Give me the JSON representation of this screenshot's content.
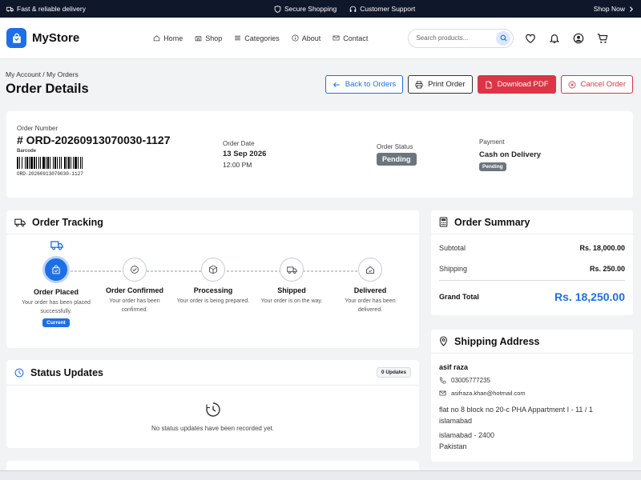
{
  "topbar": {
    "left_text": "Fast & reliable delivery",
    "secure": "Secure Shopping",
    "support": "Customer Support",
    "shop_now": "Shop Now"
  },
  "brand": {
    "name": "MyStore",
    "color": "#1d6fe6"
  },
  "nav": {
    "links": [
      "Home",
      "Shop",
      "Categories",
      "About",
      "Contact"
    ],
    "search_placeholder": "Search products..."
  },
  "breadcrumb": "My Account / My Orders",
  "page_title": "Order Details",
  "actions": {
    "back": "Back to Orders",
    "print": "Print Order",
    "pdf": "Download PDF",
    "cancel": "Cancel Order"
  },
  "order": {
    "number_label": "Order Number",
    "number": "# ORD-20260913070030-1127",
    "barcode_label": "Barcode",
    "barcode_text": "ORD-20260913070030-1127",
    "date_label": "Order Date",
    "date": "13 Sep 2026",
    "time": "12:00 PM",
    "status_label": "Order Status",
    "status": "Pending",
    "payment_label": "Payment",
    "payment_method": "Cash on Delivery",
    "payment_status": "Pending"
  },
  "tracking": {
    "title": "Order Tracking",
    "steps": [
      {
        "title": "Order Placed",
        "desc": "Your order has been placed successfully.",
        "badge": "Current"
      },
      {
        "title": "Order Confirmed",
        "desc": "Your order has been confirmed."
      },
      {
        "title": "Processing",
        "desc": "Your order is being prepared."
      },
      {
        "title": "Shipped",
        "desc": "Your order is on the way."
      },
      {
        "title": "Delivered",
        "desc": "Your order has been delivered."
      }
    ]
  },
  "status_updates": {
    "title": "Status Updates",
    "count": "0 Updates",
    "empty": "No status updates have been recorded yet."
  },
  "summary": {
    "title": "Order Summary",
    "subtotal_label": "Subtotal",
    "subtotal": "Rs. 18,000.00",
    "shipping_label": "Shipping",
    "shipping": "Rs. 250.00",
    "grand_label": "Grand Total",
    "grand": "Rs. 18,250.00"
  },
  "address": {
    "title": "Shipping Address",
    "name": "asif raza",
    "phone": "03005777235",
    "email": "asifraza.khan@hotmail.com",
    "line1": "flat no 8 block no 20-c PHA Appartment I - 11 / 1",
    "line2": "islamabad",
    "line3": "islamabad - 2400",
    "country": "Pakistan"
  }
}
